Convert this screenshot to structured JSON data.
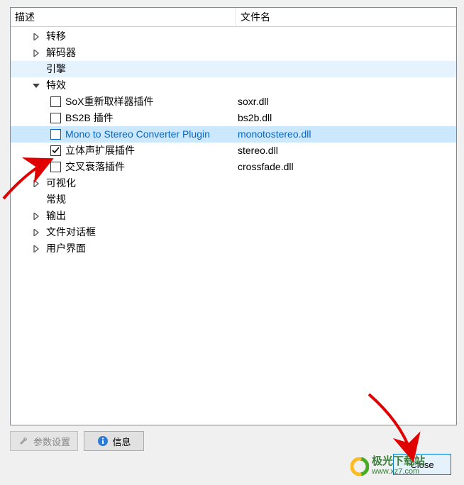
{
  "headers": {
    "description": "描述",
    "filename": "文件名"
  },
  "tree": {
    "transfer": "转移",
    "decoder": "解码器",
    "engine": "引擎",
    "effects": "特效",
    "visualization": "可视化",
    "general": "常规",
    "output": "输出",
    "file_dialogs": "文件对话框",
    "user_interface": "用户界面"
  },
  "plugins": [
    {
      "label": "SoX重新取样器插件",
      "file": "soxr.dll",
      "checked": false
    },
    {
      "label": "BS2B 插件",
      "file": "bs2b.dll",
      "checked": false
    },
    {
      "label": "Mono to Stereo Converter Plugin",
      "file": "monotostereo.dll",
      "checked": false
    },
    {
      "label": "立体声扩展插件",
      "file": "stereo.dll",
      "checked": true
    },
    {
      "label": "交叉衰落插件",
      "file": "crossfade.dll",
      "checked": false
    }
  ],
  "buttons": {
    "params": "参数设置",
    "info": "信息",
    "close": "Close"
  },
  "watermark": {
    "cn": "极光下载站",
    "url": "www.xz7.com"
  }
}
